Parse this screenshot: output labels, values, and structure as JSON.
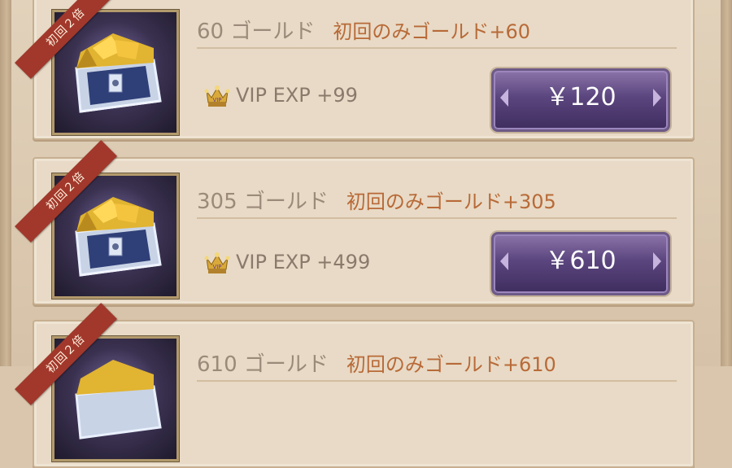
{
  "products": [
    {
      "badge": "初回２倍",
      "gold_label": "60 ゴールド",
      "bonus_label": "初回のみゴールド+60",
      "vip_label": "VIP EXP +99",
      "price_label": "￥120",
      "icon": "treasure-chest-icon"
    },
    {
      "badge": "初回２倍",
      "gold_label": "305 ゴールド",
      "bonus_label": "初回のみゴールド+305",
      "vip_label": "VIP EXP +499",
      "price_label": "￥610",
      "icon": "treasure-chest-icon"
    },
    {
      "badge": "初回２倍",
      "gold_label": "610 ゴールド",
      "bonus_label": "初回のみゴールド+610",
      "icon": "treasure-chest-icon"
    }
  ],
  "colors": {
    "card_bg": "#e8dac6",
    "bonus_text": "#b86a38",
    "ribbon": "#a1382b",
    "button_purple": "#5b457e"
  },
  "vip_icon_label": "VIP"
}
